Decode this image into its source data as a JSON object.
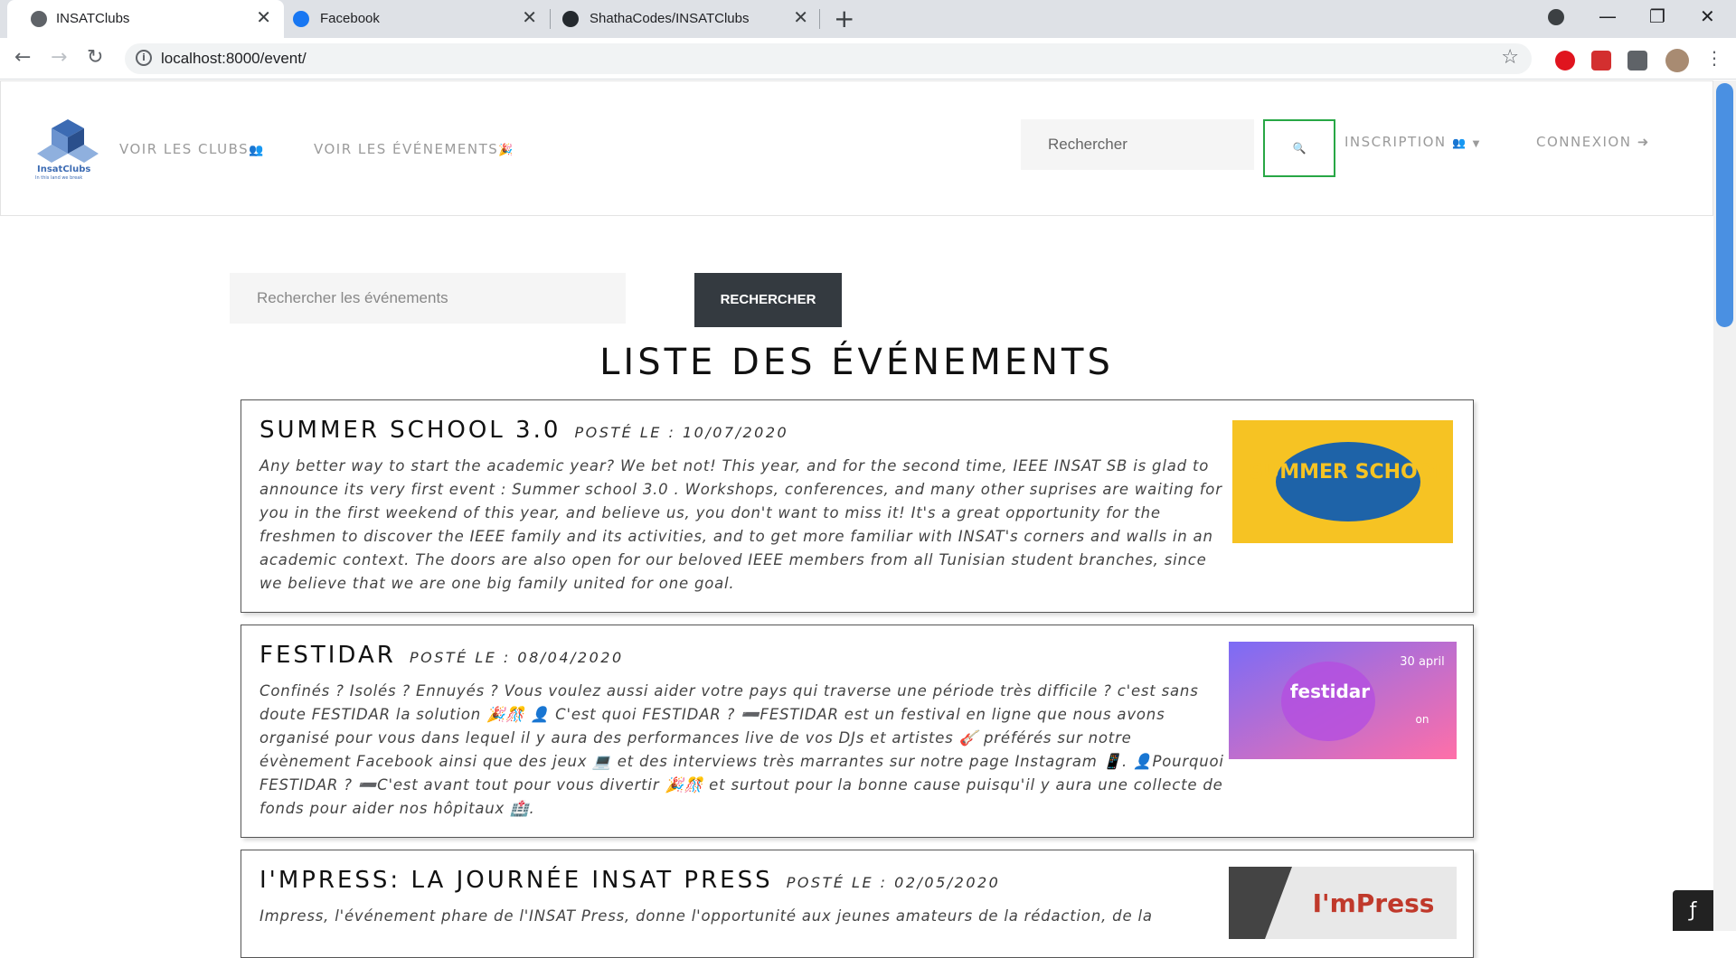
{
  "browser": {
    "tabs": [
      {
        "title": "INSATClubs",
        "close": "✕"
      },
      {
        "title": "Facebook",
        "close": "✕"
      },
      {
        "title": "ShathaCodes/INSATClubs",
        "close": "✕"
      }
    ],
    "new_tab": "+",
    "url": "localhost:8000/event/",
    "window_controls": {
      "minimize": "—",
      "restore": "❐",
      "close": "✕"
    }
  },
  "site": {
    "logo_text": "InsatClubs",
    "logo_sub": "In this land we break",
    "nav": {
      "clubs": "VOIR LES CLUBS",
      "events": "VOIR LES ÉVÉNEMENTS",
      "search_placeholder": "Rechercher",
      "inscription": "INSCRIPTION",
      "connexion": "CONNEXION"
    }
  },
  "events_page": {
    "search_placeholder": "Rechercher les événements",
    "search_button": "RECHERCHER",
    "title": "LISTE DES ÉVÉNEMENTS",
    "events": [
      {
        "title": "SUMMER SCHOOL 3.0",
        "date": "POSTÉ LE : 10/07/2020",
        "description": "Any better way to start the academic year? We bet not! This year, and for the second time, IEEE INSAT SB is glad to announce its very first event : Summer school 3.0 . Workshops, conferences, and many other suprises are waiting for you in the first weekend of this year, and believe us, you don't want to miss it! It's a great opportunity for the freshmen to discover the IEEE family and its activities, and to get more familiar with INSAT's corners and walls in an academic context. The doors are also open for our beloved IEEE members from all Tunisian student branches, since we believe that we are one big family united for one goal.",
        "image_text": "SUMMER SCHOOL"
      },
      {
        "title": "FESTIDAR",
        "date": "POSTÉ LE : 08/04/2020",
        "description": "Confinés ? Isolés ? Ennuyés ? Vous voulez aussi aider votre pays qui traverse une période très difficile ? c'est sans doute FESTIDAR la solution 🎉🎊 👤 C'est quoi FESTIDAR ? ➖FESTIDAR est un festival en ligne que nous avons organisé pour vous dans lequel il y aura des performances live de vos DJs et artistes 🎸 préférés sur notre évènement Facebook ainsi que des jeux 💻 et des interviews très marrantes sur notre page Instagram 📱. 👤Pourquoi FESTIDAR ? ➖C'est avant tout pour vous divertir 🎉🎊 et surtout pour la bonne cause puisqu'il y aura une collecte de fonds pour aider nos hôpitaux 🏥.",
        "image_text": "festidar",
        "image_date": "30 april",
        "image_on": "on"
      },
      {
        "title": "I'MPRESS: LA JOURNÉE INSAT PRESS",
        "date": "POSTÉ LE : 02/05/2020",
        "description": "Impress, l'événement phare de l'INSAT Press, donne l'opportunité aux jeunes amateurs de la rédaction, de la",
        "image_text": "I'mPress"
      }
    ]
  },
  "symfony_badge": "ƒ"
}
